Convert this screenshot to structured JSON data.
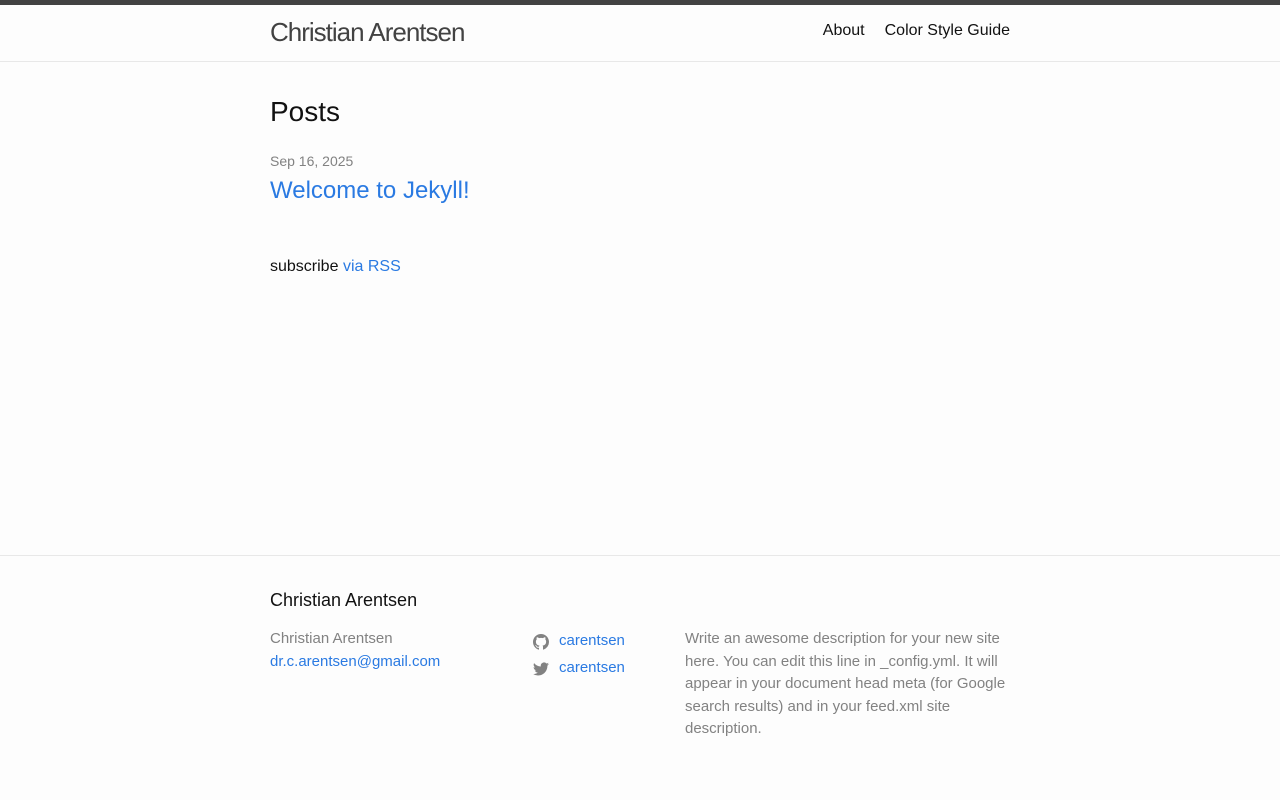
{
  "header": {
    "site_title": "Christian Arentsen",
    "nav": [
      {
        "label": "About"
      },
      {
        "label": "Color Style Guide"
      }
    ]
  },
  "main": {
    "heading": "Posts",
    "posts": [
      {
        "date": "Sep 16, 2025",
        "title": "Welcome to Jekyll!"
      }
    ],
    "rss": {
      "prefix": "subscribe",
      "link_label": "via RSS"
    }
  },
  "footer": {
    "heading": "Christian Arentsen",
    "name": "Christian Arentsen",
    "email": "dr.c.arentsen@gmail.com",
    "social": [
      {
        "icon": "github-icon",
        "username": "carentsen"
      },
      {
        "icon": "twitter-icon",
        "username": "carentsen"
      }
    ],
    "description": "Write an awesome description for your new site here. You can edit this line in _config.yml. It will appear in your document head meta (for Google search results) and in your feed.xml site description."
  },
  "colors": {
    "accent": "#2a7ae2",
    "text": "#111111",
    "muted": "#828282",
    "top_bar": "#424242"
  }
}
